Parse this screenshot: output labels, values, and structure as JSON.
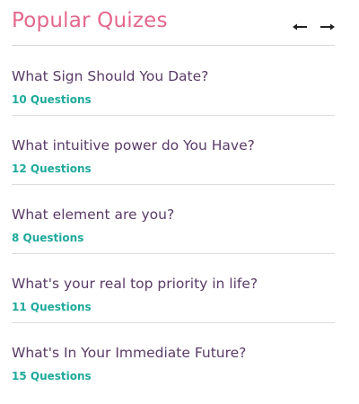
{
  "widget": {
    "title": "Popular Quizes",
    "prev_icon": "arrow-left-icon",
    "next_icon": "arrow-right-icon"
  },
  "colors": {
    "title": "#e4678a",
    "quiz_title": "#5a3b67",
    "question_count": "#1fa99b",
    "divider": "#d7d7d7"
  },
  "quizzes": [
    {
      "title": "What Sign Should You Date?",
      "count": "10 Questions"
    },
    {
      "title": "What intuitive power do You Have?",
      "count": "12 Questions"
    },
    {
      "title": "What element are you?",
      "count": "8 Questions"
    },
    {
      "title": "What's your real top priority in life?",
      "count": "11 Questions"
    },
    {
      "title": "What's In Your Immediate Future?",
      "count": "15 Questions"
    }
  ]
}
